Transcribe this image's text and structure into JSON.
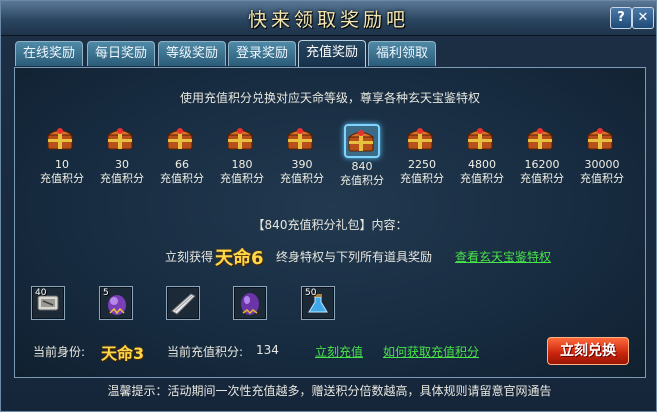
{
  "window": {
    "title": "快来领取奖励吧",
    "help_label": "?",
    "close_label": "✕"
  },
  "tabs": [
    {
      "label": "在线奖励",
      "active": false
    },
    {
      "label": "每日奖励",
      "active": false
    },
    {
      "label": "等级奖励",
      "active": false
    },
    {
      "label": "登录奖励",
      "active": false
    },
    {
      "label": "充值奖励",
      "active": true
    },
    {
      "label": "福利领取",
      "active": false
    }
  ],
  "intro": "使用充值积分兑换对应天命等级，尊享各种玄天宝鉴特权",
  "rewards": [
    {
      "points": "10",
      "unit": "充值积分",
      "selected": false
    },
    {
      "points": "30",
      "unit": "充值积分",
      "selected": false
    },
    {
      "points": "66",
      "unit": "充值积分",
      "selected": false
    },
    {
      "points": "180",
      "unit": "充值积分",
      "selected": false
    },
    {
      "points": "390",
      "unit": "充值积分",
      "selected": false
    },
    {
      "points": "840",
      "unit": "充值积分",
      "selected": true
    },
    {
      "points": "2250",
      "unit": "充值积分",
      "selected": false
    },
    {
      "points": "4800",
      "unit": "充值积分",
      "selected": false
    },
    {
      "points": "16200",
      "unit": "充值积分",
      "selected": false
    },
    {
      "points": "30000",
      "unit": "充值积分",
      "selected": false
    }
  ],
  "package_title": "【840充值积分礼包】内容：",
  "grant": {
    "prefix": "立刻获得",
    "badge": "天命6",
    "suffix": "终身特权与下列所有道具奖励",
    "link": "查看玄天宝鉴特权"
  },
  "items": [
    {
      "icon": "scroll-item-icon",
      "count": "40"
    },
    {
      "icon": "purple-orb-icon",
      "count": "5"
    },
    {
      "icon": "blade-item-icon",
      "count": ""
    },
    {
      "icon": "purple-egg-icon",
      "count": ""
    },
    {
      "icon": "blue-potion-icon",
      "count": "50"
    }
  ],
  "status": {
    "identity_label": "当前身份:",
    "identity_badge": "天命3",
    "points_label": "当前充值积分:",
    "points_value": "134",
    "recharge_link": "立刻充值",
    "howto_link": "如何获取充值积分",
    "redeem_label": "立刻兑换"
  },
  "tip": "温馨提示：活动期间一次性充值越多，赠送积分倍数越高，具体规则请留意官网通告",
  "colors": {
    "accent_gold": "#ffd84a",
    "link_green": "#48e24a",
    "button_red": "#c9230c",
    "selection_blue": "#7fd4ff"
  }
}
